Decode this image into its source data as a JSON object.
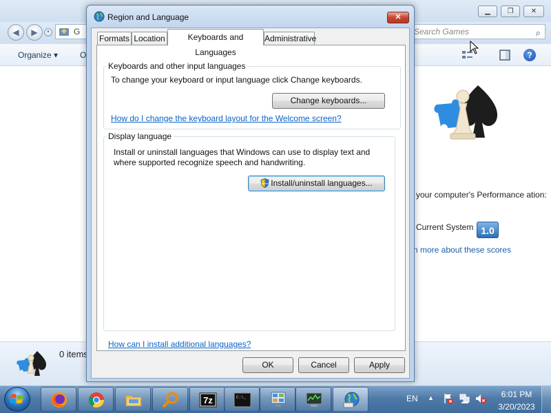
{
  "background_window": {
    "address_text": "G",
    "search_placeholder": "Search Games",
    "toolbar": {
      "organize_label": "Organize ▾",
      "partial_label": "O"
    },
    "perf_text": "your computer's Performance ation:",
    "current_system_label": "Current System",
    "score": "1.0",
    "learn_more_link": "rn more about these scores",
    "status_text": "0 items"
  },
  "dialog": {
    "title": "Region and Language",
    "close_label": "✕",
    "tabs": [
      {
        "label": "Formats"
      },
      {
        "label": "Location"
      },
      {
        "label": "Keyboards and Languages"
      },
      {
        "label": "Administrative"
      }
    ],
    "active_tab": "Keyboards and Languages",
    "keyboards_group": {
      "title": "Keyboards and other input languages",
      "description": "To change your keyboard or input language click Change keyboards.",
      "button_label": "Change keyboards...",
      "link": "How do I change the keyboard layout for the Welcome screen?"
    },
    "display_group": {
      "title": "Display language",
      "description": "Install or uninstall languages that Windows can use to display text and where supported recognize speech and handwriting.",
      "button_label": "Install/uninstall languages..."
    },
    "bottom_link": "How can I install additional languages?",
    "buttons": {
      "ok": "OK",
      "cancel": "Cancel",
      "apply": "Apply"
    }
  },
  "taskbar": {
    "apps": [
      {
        "name": "firefox-icon"
      },
      {
        "name": "chrome-icon"
      },
      {
        "name": "file-explorer-icon"
      },
      {
        "name": "search-magnifier-icon"
      },
      {
        "name": "7zip-icon"
      },
      {
        "name": "command-prompt-icon"
      },
      {
        "name": "control-panel-icon"
      },
      {
        "name": "system-monitor-icon"
      },
      {
        "name": "region-language-icon"
      }
    ],
    "tray": {
      "language": "EN",
      "time": "6:01 PM",
      "date": "3/20/2023"
    }
  },
  "colors": {
    "taskbar": "#4f7aa8",
    "dialog_frame": "#bfd4ec",
    "link": "#0a63c6",
    "close_button": "#c7452f"
  }
}
